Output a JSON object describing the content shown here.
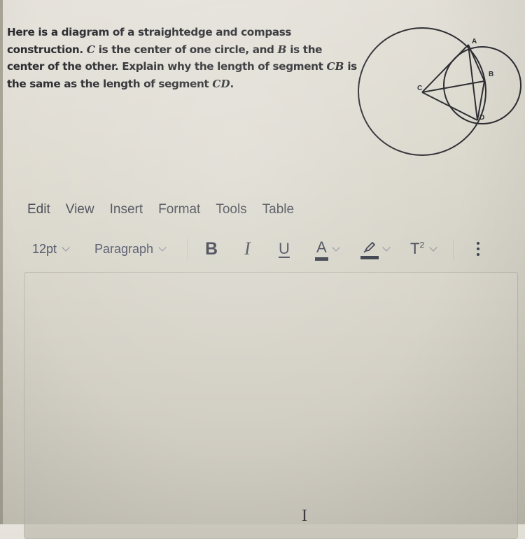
{
  "question": {
    "parts": [
      {
        "text": "Here is a diagram of a straightedge and compass construction. ",
        "italic": false
      },
      {
        "text": "C",
        "italic": true
      },
      {
        "text": " is the center of one circle, and ",
        "italic": false
      },
      {
        "text": "B",
        "italic": true
      },
      {
        "text": " is the center of the other. Explain why the length of segment ",
        "italic": false
      },
      {
        "text": "CB",
        "italic": true
      },
      {
        "text": " is the same as the length of segment ",
        "italic": false
      },
      {
        "text": "CD",
        "italic": true
      },
      {
        "text": ".",
        "italic": false
      }
    ]
  },
  "diagram": {
    "points": {
      "A": "A",
      "B": "B",
      "C": "C",
      "D": "D"
    },
    "description": "Two intersecting circles centered at C and B, meeting at A and D; segments CA, CB, CD, AD, AB, BD drawn"
  },
  "menubar": {
    "items": [
      "Edit",
      "View",
      "Insert",
      "Format",
      "Tools",
      "Table"
    ]
  },
  "toolbar": {
    "font_size": "12pt",
    "block_format": "Paragraph",
    "bold_label": "B",
    "italic_label": "I",
    "underline_label": "U",
    "text_color_label": "A",
    "superscript_label": "T",
    "superscript_exp": "2",
    "icons": {
      "font_size_chevron": "chevron-down-icon",
      "block_chevron": "chevron-down-icon",
      "text_color": "text-color-icon",
      "highlight": "highlighter-icon",
      "superscript": "superscript-icon",
      "more": "more-vertical-icon"
    }
  },
  "editor": {
    "value": "",
    "cursor_glyph": "I"
  }
}
